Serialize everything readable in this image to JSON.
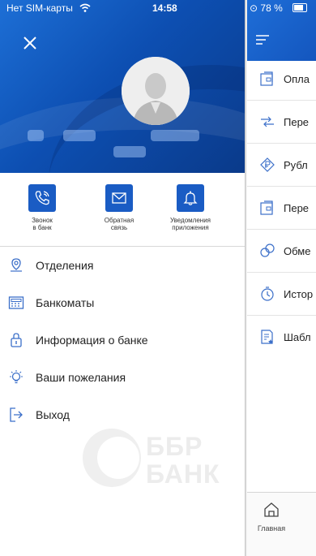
{
  "status": {
    "carrier": "Нет SIM-карты",
    "time": "14:58",
    "battery": "78 %"
  },
  "quick_actions": [
    {
      "label": "Звонок\nв банк",
      "icon": "phone-icon"
    },
    {
      "label": "Обратная\nсвязь",
      "icon": "envelope-icon"
    },
    {
      "label": "Уведомления\nприложения",
      "icon": "bell-icon"
    }
  ],
  "menu": [
    {
      "label": "Отделения",
      "icon": "location-pin-icon"
    },
    {
      "label": "Банкоматы",
      "icon": "atm-icon"
    },
    {
      "label": "Информация о банке",
      "icon": "lock-info-icon"
    },
    {
      "label": "Ваши пожелания",
      "icon": "lightbulb-icon"
    },
    {
      "label": "Выход",
      "icon": "exit-icon"
    }
  ],
  "logo": {
    "line1": "ББР",
    "line2": "БАНК"
  },
  "right_panel": {
    "items": [
      {
        "label": "Опла",
        "icon": "wallet-icon"
      },
      {
        "label": "Пере",
        "icon": "transfer-arrows-icon"
      },
      {
        "label": "Рубл",
        "icon": "ruble-diamond-icon"
      },
      {
        "label": "Пере",
        "icon": "wallet-transfer-icon"
      },
      {
        "label": "Обме",
        "icon": "exchange-icon"
      },
      {
        "label": "Истор",
        "icon": "history-icon"
      },
      {
        "label": "Шабл",
        "icon": "template-icon"
      }
    ],
    "tab": {
      "label": "Главная",
      "icon": "home-icon"
    }
  },
  "colors": {
    "brand_blue": "#1a5cc4",
    "header_dark": "#0a3a8a"
  }
}
